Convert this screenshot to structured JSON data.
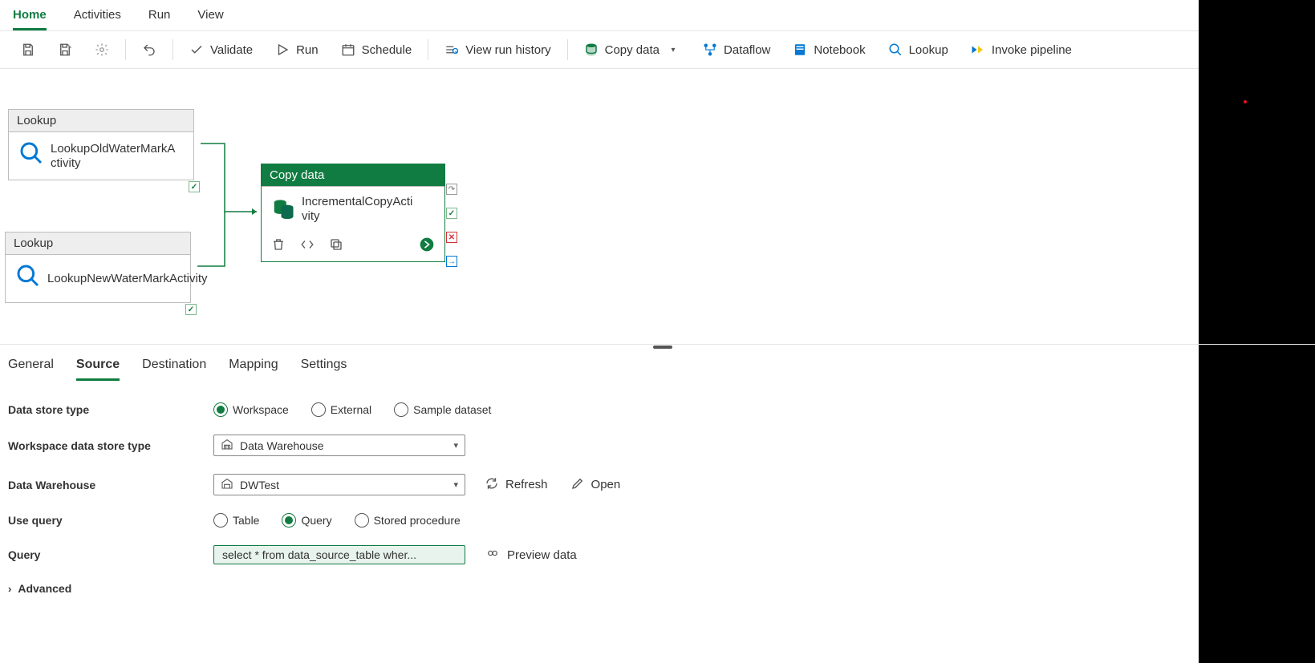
{
  "tabs": {
    "home": "Home",
    "activities": "Activities",
    "run": "Run",
    "view": "View"
  },
  "toolbar": {
    "validate": "Validate",
    "run": "Run",
    "schedule": "Schedule",
    "history": "View run history",
    "copydata": "Copy data",
    "dataflow": "Dataflow",
    "notebook": "Notebook",
    "lookup": "Lookup",
    "invoke": "Invoke pipeline"
  },
  "nodes": {
    "lookup_type": "Lookup",
    "old_name": "LookupOldWaterMarkActivity",
    "new_name": "LookupNewWaterMarkActivity",
    "copy_type": "Copy data",
    "copy_name": "IncrementalCopyActivity"
  },
  "panelTabs": {
    "general": "General",
    "source": "Source",
    "destination": "Destination",
    "mapping": "Mapping",
    "settings": "Settings"
  },
  "source": {
    "datastore_type_label": "Data store type",
    "workspace": "Workspace",
    "external": "External",
    "sample": "Sample dataset",
    "ws_type_label": "Workspace data store type",
    "ws_type_value": "Data Warehouse",
    "dw_label": "Data Warehouse",
    "dw_value": "DWTest",
    "refresh": "Refresh",
    "open": "Open",
    "use_query_label": "Use query",
    "table": "Table",
    "query": "Query",
    "sproc": "Stored procedure",
    "query_label": "Query",
    "query_value": "select * from data_source_table wher...",
    "preview": "Preview data",
    "advanced": "Advanced"
  }
}
